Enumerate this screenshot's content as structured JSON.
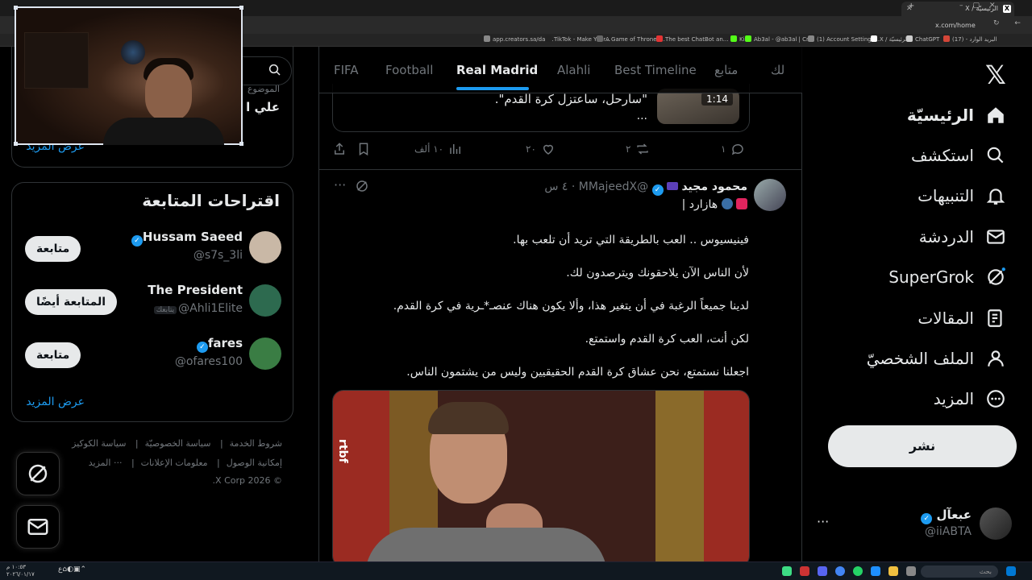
{
  "browser": {
    "active_tab_title": "الرئيسيّة / X",
    "url": "x.com/home",
    "bookmarks": [
      {
        "label": "app.creators.sa/das...",
        "color": "#888888"
      },
      {
        "label": "TikTok - Make Your...",
        "color": "#222222"
      },
      {
        "label": "A Game of Thrones...",
        "color": "#666666"
      },
      {
        "label": "The best ChatBot an...",
        "color": "#e33333"
      },
      {
        "label": "Kick",
        "color": "#53fc18"
      },
      {
        "label": "Ab3al - @ab3al | Cr...",
        "color": "#53fc18"
      },
      {
        "label": "(1) Account Settings...",
        "color": "#888888"
      },
      {
        "label": "X / الرئيسيّة",
        "color": "#ffffff"
      },
      {
        "label": "ChatGPT",
        "color": "#cccccc"
      },
      {
        "label": "(17) - البريد الوارد",
        "color": "#d44638"
      }
    ]
  },
  "nav": {
    "items": [
      {
        "label": "الرئيسيّة",
        "icon": "home-icon",
        "bold": true
      },
      {
        "label": "استكشف",
        "icon": "search-icon"
      },
      {
        "label": "التنبيهات",
        "icon": "bell-icon"
      },
      {
        "label": "الدردشة",
        "icon": "mail-icon"
      },
      {
        "label": "SuperGrok",
        "icon": "grok-icon"
      },
      {
        "label": "المقالات",
        "icon": "article-icon"
      },
      {
        "label": "الملف الشخصيّ",
        "icon": "profile-icon"
      },
      {
        "label": "المزيد",
        "icon": "more-circle-icon"
      }
    ],
    "post_button": "نشر",
    "account": {
      "name": "عبعآل",
      "handle": "@iiABTA"
    }
  },
  "feed": {
    "tabs": [
      "FIFA",
      "Football",
      "Real Madrid",
      "Alahli",
      "Best Timeline",
      "متابع",
      "لك"
    ],
    "active_tab": "Real Madrid",
    "quoted": {
      "text": "\"سارحل، ساعتزل كرة القدم\".",
      "ellipsis": "...",
      "duration": "1:14"
    },
    "actions": {
      "replies": "١",
      "reposts": "٢",
      "likes": "٢٠",
      "views": "١٠ ألف"
    },
    "post": {
      "name": "محمود مجيد",
      "handle": "@MMajeedX",
      "time": "٤ س",
      "tag": "هازارد |",
      "lines": [
        "فينيسيوس .. العب بالطريقة التي تريد أن تلعب بها.",
        "لأن الناس الآن يلاحقونك ويترصدون لك.",
        "لدينا جميعاً الرغبة في أن يتغير هذا، وألا يكون هناك عنصـ*ـرية في كرة القدم.",
        "لكن أنت، العب كرة القدم واستمتع.",
        "اجعلنا نستمتع، نحن عشاق كرة القدم الحقيقيين وليس من يشتمون الناس."
      ],
      "media_logo": "rtbf"
    }
  },
  "sidebar": {
    "trend": {
      "meta": "الموضوع",
      "name": "علي ا"
    },
    "show_more": "عرض المزيد",
    "wtf_title": "اقتراحات المتابعة",
    "suggestions": [
      {
        "name": "Hussam Saeed",
        "handle": "@s7s_3li",
        "verified": true,
        "follows_you": "",
        "button": "متابعة",
        "avatar_color": "#c9b8a6"
      },
      {
        "name": "The President",
        "handle": "@Ahli1Elite",
        "verified": false,
        "follows_you": "يتابعك",
        "button": "المتابعة أيضًا",
        "avatar_color": "#2d6a4f"
      },
      {
        "name": "fares",
        "handle": "@ofares100",
        "verified": true,
        "follows_you": "",
        "button": "متابعة",
        "avatar_color": "#3a7d44"
      }
    ],
    "footer": {
      "row1": [
        "شروط الخدمة",
        "سياسة الخصوصيّة",
        "سياسة الكوكيز"
      ],
      "row2": [
        "إمكانية الوصول",
        "معلومات الإعلانات",
        "··· المزيد"
      ],
      "copyright": "© 2026 X Corp."
    }
  },
  "taskbar": {
    "time": "١٠:٥٣ م",
    "date": "٢٠٢٦/٠١/١٧",
    "search": "بحث"
  }
}
